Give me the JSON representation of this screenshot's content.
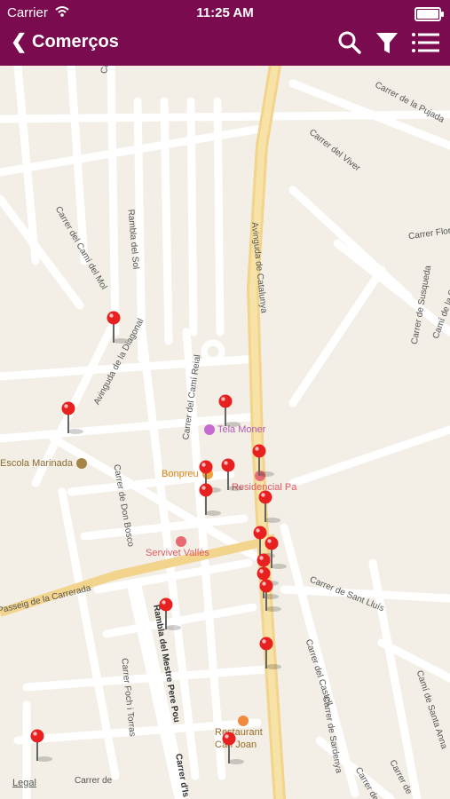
{
  "status": {
    "carrier": "Carrier",
    "time": "11:25 AM"
  },
  "header": {
    "back_icon": "chevron-left-icon",
    "title": "Comerços",
    "icons": [
      "search-icon",
      "filter-icon",
      "list-icon"
    ]
  },
  "colors": {
    "header": "#7a0b4e",
    "map_bg": "#f3efe6",
    "road": "#ffffff",
    "main_road": "#f2d48c",
    "pin": "#e82020"
  },
  "map": {
    "streets": [
      "Carrer de Ceferi",
      "Carrer de la Pujada",
      "Carrer del Viver",
      "Carrer Flor",
      "Carrer del Camí del Mol",
      "Rambla del Sol",
      "Avinguda de Catalunya",
      "Carrer de Susqueda",
      "Camí de la Sé",
      "Avinguda de la Diagonal",
      "Carrer del Camí Reial",
      "Carrer de Don Bosco",
      "Passeig de la Carrerada",
      "Carrer de Sant Lluís",
      "Rambla del Mestre Pere Pou",
      "Carrer del Castell",
      "Carrer de Sardenya",
      "Camí de Santa Anna",
      "Carrer Foch i Torras",
      "Carrer d'Is",
      "Carrer de",
      "Carrer de",
      "Carrer de"
    ],
    "pois": [
      "Escola Marinada",
      "Bonpreu",
      "Residencial Pa",
      "Servivet Vallès",
      "Restaurant Can Joan",
      "Tela Moner"
    ],
    "legal": "Legal"
  }
}
